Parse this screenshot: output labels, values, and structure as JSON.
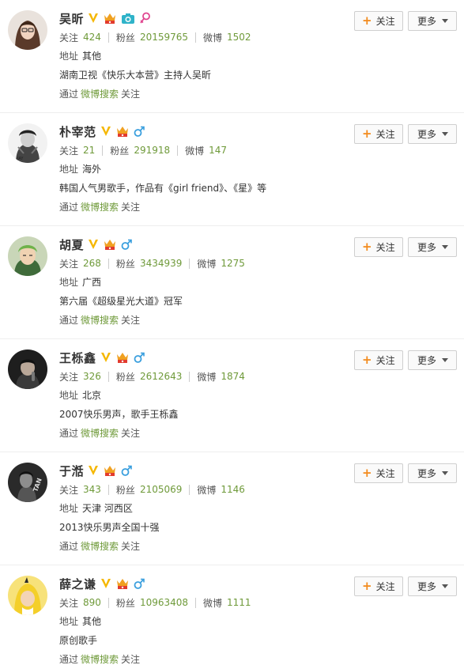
{
  "labels": {
    "follow": "关注",
    "fans": "粉丝",
    "weibo": "微博",
    "address": "地址",
    "via": "通过",
    "via_suffix": "关注",
    "follow_button": "关注",
    "more_button": "更多",
    "plus": "+"
  },
  "users": [
    {
      "name": "吴昕",
      "follow_count": "424",
      "fans_count": "20159765",
      "weibo_count": "1502",
      "address": "其他",
      "intro": "湖南卫视《快乐大本营》主持人吴昕",
      "via_source": "微博搜索",
      "gender": "female",
      "badges": [
        "verified-v-icon",
        "vip-crown-icon",
        "camera-icon",
        "female-icon"
      ]
    },
    {
      "name": "朴宰范",
      "follow_count": "21",
      "fans_count": "291918",
      "weibo_count": "147",
      "address": "海外",
      "intro": "韩国人气男歌手，作品有《girl friend》、《星》等",
      "via_source": "微博搜索",
      "gender": "male",
      "badges": [
        "verified-v-icon",
        "vip-crown-icon",
        "male-icon"
      ]
    },
    {
      "name": "胡夏",
      "follow_count": "268",
      "fans_count": "3434939",
      "weibo_count": "1275",
      "address": "广西",
      "intro": "第六届《超级星光大道》冠军",
      "via_source": "微博搜索",
      "gender": "male",
      "badges": [
        "verified-v-icon",
        "vip-crown-icon",
        "male-icon"
      ]
    },
    {
      "name": "王栎鑫",
      "follow_count": "326",
      "fans_count": "2612643",
      "weibo_count": "1874",
      "address": "北京",
      "intro": "2007快乐男声，歌手王栎鑫",
      "via_source": "微博搜索",
      "gender": "male",
      "badges": [
        "verified-v-icon",
        "vip-crown-icon",
        "male-icon"
      ]
    },
    {
      "name": "于湉",
      "follow_count": "343",
      "fans_count": "2105069",
      "weibo_count": "1146",
      "address": "天津 河西区",
      "intro": "2013快乐男声全国十强",
      "via_source": "微博搜索",
      "gender": "male",
      "badges": [
        "verified-v-icon",
        "vip-crown-icon",
        "male-icon"
      ]
    },
    {
      "name": "薛之谦",
      "follow_count": "890",
      "fans_count": "10963408",
      "weibo_count": "1111",
      "address": "其他",
      "intro": "原创歌手",
      "via_source": "微博搜索",
      "gender": "male",
      "badges": [
        "verified-v-icon",
        "vip-crown-icon",
        "male-icon"
      ]
    }
  ],
  "colors": {
    "green_value": "#6f9a3a",
    "verified_v": "#f5b700",
    "crown": "#f0a020",
    "male": "#3a9fde",
    "female": "#e0458f",
    "camera": "#2fb3c9",
    "plus": "#f28a1c"
  }
}
